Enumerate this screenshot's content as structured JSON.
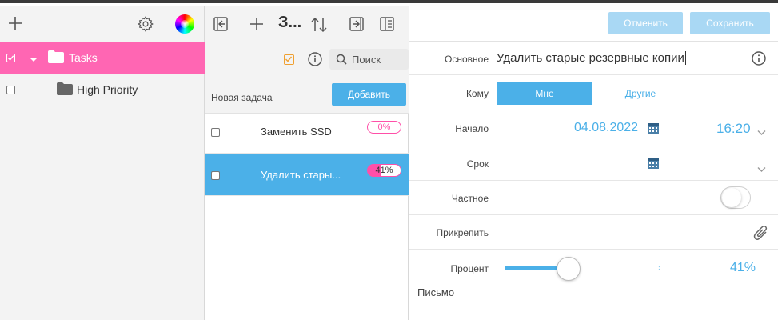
{
  "left": {
    "folders": [
      {
        "label": "Tasks",
        "selected": true
      },
      {
        "label": "High Priority",
        "selected": false
      }
    ]
  },
  "middle": {
    "title": "З...",
    "search_placeholder": "Поиск",
    "new_task_placeholder": "Новая задача",
    "add_label": "Добавить",
    "tasks": [
      {
        "title": "Заменить SSD",
        "progress_label": "0%",
        "progress": 0
      },
      {
        "title": "Удалить стары...",
        "progress_label": "41%",
        "progress": 41
      }
    ]
  },
  "right": {
    "cancel_label": "Отменить",
    "save_label": "Сохранить",
    "fields": {
      "main_label": "Основное",
      "main_value": "Удалить старые резервные копии",
      "to_label": "Кому",
      "to_me": "Мне",
      "to_others": "Другие",
      "start_label": "Начало",
      "start_date": "04.08.2022",
      "start_time": "16:20",
      "due_label": "Срок",
      "private_label": "Частное",
      "attach_label": "Прикрепить",
      "percent_label": "Процент",
      "percent_value": "41%",
      "percent": 41,
      "letter_label": "Письмо"
    }
  },
  "colors": {
    "accent_pink": "#ff66b3",
    "accent_blue": "#4bb0e8",
    "disabled_blue": "#a9d8f4"
  },
  "icons": [
    "plus-icon",
    "gear-icon",
    "color-wheel-icon",
    "folder-icon",
    "checkbox-icon",
    "triangle-down-icon",
    "collapse-left-icon",
    "sort-icon",
    "export-icon",
    "columns-icon",
    "checklist-icon",
    "info-icon",
    "search-icon",
    "calendar-icon",
    "chevron-down-icon",
    "paperclip-icon"
  ]
}
